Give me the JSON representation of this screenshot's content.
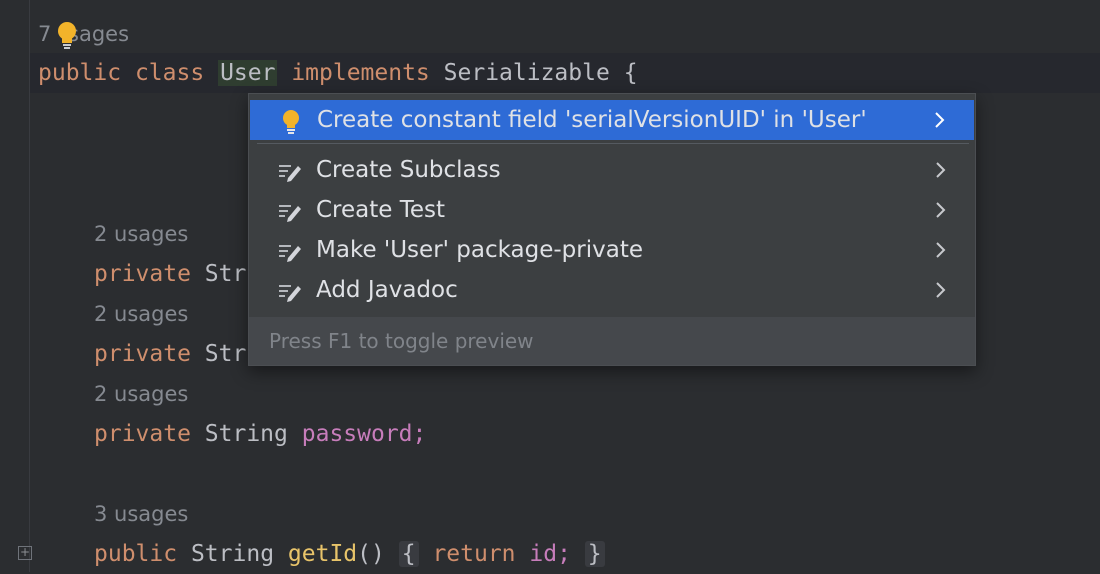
{
  "editor": {
    "usage_7": "7 usages",
    "usage_7_suffix": "sages",
    "class_decl": {
      "kw_public": "public",
      "kw_class": "class",
      "name": "User",
      "kw_implements": "implements",
      "iface": "Serializable",
      "brace": "{"
    },
    "usage_2": "2 usages",
    "usage_3": "3 usages",
    "field_prefix": "private",
    "type_string": "String",
    "clipped_str": "Str",
    "password_field": "password;",
    "method": {
      "kw_public": "public",
      "type": "String",
      "name": "getId",
      "parens": "()",
      "open_brace": "{",
      "kw_return": "return",
      "field": "id;",
      "close_brace": "}"
    }
  },
  "popup": {
    "items": [
      {
        "label": "Create constant field 'serialVersionUID' in 'User'",
        "icon": "lightbulb-icon",
        "selected": true
      },
      {
        "label": "Create Subclass",
        "icon": "intention-pencil-icon"
      },
      {
        "label": "Create Test",
        "icon": "intention-pencil-icon"
      },
      {
        "label": "Make 'User' package-private",
        "icon": "intention-pencil-icon"
      },
      {
        "label": "Add Javadoc",
        "icon": "intention-pencil-icon"
      }
    ],
    "footer": "Press F1 to toggle preview"
  },
  "colors": {
    "selection": "#2e6bd6",
    "keyword": "#cf8e6d",
    "field": "#c77dbb",
    "bulb": "#f2b32a"
  }
}
